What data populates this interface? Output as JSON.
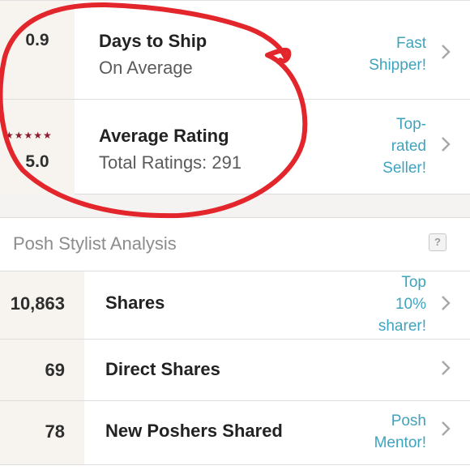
{
  "shipping": {
    "value": "0.9",
    "title": "Days to Ship",
    "subtitle": "On Average",
    "badge_line1": "Fast",
    "badge_line2": "Shipper!"
  },
  "rating": {
    "stars": "★★★★★",
    "value": "5.0",
    "title": "Average Rating",
    "subtitle": "Total Ratings: 291",
    "badge_line1": "Top-",
    "badge_line2": "rated",
    "badge_line3": "Seller!"
  },
  "section": {
    "title": "Posh Stylist Analysis",
    "help_label": "?"
  },
  "stats": [
    {
      "value": "10,863",
      "label": "Shares",
      "badge_line1": "Top",
      "badge_line2": "10%",
      "badge_line3": "sharer!"
    },
    {
      "value": "69",
      "label": "Direct Shares"
    },
    {
      "value": "78",
      "label": "New Poshers Shared",
      "badge_line1": "Posh",
      "badge_line2": "Mentor!"
    }
  ],
  "colors": {
    "accent": "#3fa3bd",
    "annotation": "#e2262b",
    "star": "#8a1c2d"
  },
  "icons": {
    "chevron": "chevron-right-icon",
    "help": "help-icon"
  }
}
